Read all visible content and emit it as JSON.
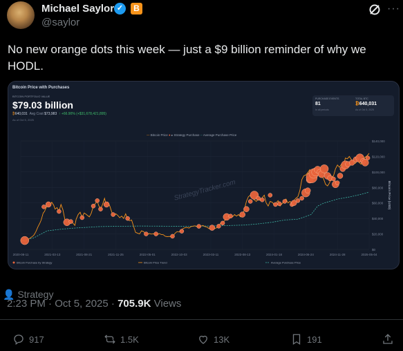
{
  "author": {
    "name": "Michael Saylor",
    "handle": "@saylor",
    "org_badge_letter": "B"
  },
  "tweet": {
    "text": "No new orange dots this week — just a $9 billion reminder of why we HODL."
  },
  "card": {
    "title": "Bitcoin Price with Purchases",
    "portfolio_label": "BITCOIN PORTFOLIO VALUE",
    "portfolio_value": "$79.03 billion",
    "btc_held": "640,031",
    "avg_cost_label": "Avg Cost",
    "avg_cost": "$73,983",
    "change": "↑ +66.90%",
    "change_detail": "(+$31,678,421,895)",
    "as_of": "As of Oct 5, 2025",
    "stats": {
      "events_label": "PURCHASE EVENTS",
      "events_value": "81",
      "events_sub": "In all periods",
      "total_label": "TOTAL BTC",
      "total_value": "640,031",
      "total_sub": "As of Oct 5, 2025"
    },
    "legend_top": {
      "series1": "Bitcoin Price",
      "series2": "Strategy Purchase",
      "series3": "Average Purchase Price"
    },
    "legend_bottom": {
      "item1": "Bitcoin Purchase by Strategy",
      "item2": "Bitcoin Price Trend",
      "item3": "Average Purchase Price"
    },
    "watermark": "StrategyTracker.com",
    "y_axis_title": "Bitcoin Price (USD)"
  },
  "chart_data": {
    "type": "line",
    "title": "Bitcoin Price with Purchases",
    "ylabel": "Bitcoin Price (USD)",
    "ylim": [
      0,
      140000
    ],
    "yticks": [
      "$0",
      "$20,000",
      "$40,000",
      "$60,000",
      "$80,000",
      "$100,000",
      "$120,000",
      "$140,000"
    ],
    "xticks": [
      "2020-08-11",
      "2021-03-13",
      "2021-08-21",
      "2021-11-25",
      "2022-05-01",
      "2022-10-03",
      "2023-03-11",
      "2023-08-13",
      "2024-01-18",
      "2024-06-24",
      "2024-11-28",
      "2025-05-04"
    ],
    "series": [
      {
        "name": "Bitcoin Price",
        "x": [
          0,
          4,
          7,
          10,
          14,
          18,
          20,
          23,
          26,
          29,
          31,
          34,
          36,
          39,
          42,
          44,
          47,
          50,
          52,
          55,
          58,
          61,
          64,
          67,
          70,
          73,
          76,
          79,
          82,
          84,
          87,
          90,
          93,
          96,
          98,
          101,
          104,
          107,
          110,
          113,
          116,
          118,
          121,
          124,
          127,
          129,
          132,
          135,
          138,
          141,
          144,
          147,
          150,
          153,
          156,
          159,
          162,
          165,
          168,
          171,
          174,
          177,
          180,
          183,
          186,
          189,
          192,
          195,
          198,
          201,
          204,
          207,
          210,
          213,
          216,
          219,
          222,
          225,
          228,
          231,
          234,
          237,
          240,
          243,
          246,
          249,
          252,
          255,
          258,
          261,
          264,
          267,
          270,
          273,
          276,
          279,
          282,
          285,
          288,
          291,
          294,
          297,
          300,
          303,
          306,
          309,
          312,
          315,
          318,
          321,
          324,
          327,
          330,
          333,
          336,
          339,
          342,
          345,
          348,
          351,
          354,
          357,
          360,
          363,
          366,
          369,
          372,
          375,
          378,
          381,
          384,
          387,
          390,
          393,
          396,
          399,
          402,
          405,
          408,
          411,
          414,
          417,
          420,
          423,
          426,
          429,
          432,
          435,
          438,
          441,
          444,
          447,
          450,
          453,
          456,
          459,
          462,
          465,
          468,
          471,
          474,
          477,
          480,
          483,
          486,
          489,
          492,
          495,
          498,
          501,
          504,
          507,
          510,
          513,
          516,
          519,
          522,
          525,
          528
        ],
        "values": [
          11500,
          11000,
          10800,
          12500,
          14500,
          17000,
          18500,
          23000,
          29000,
          34000,
          38000,
          47000,
          49000,
          55000,
          58000,
          56000,
          61000,
          57000,
          52000,
          54000,
          49000,
          58000,
          51000,
          38000,
          35000,
          32000,
          36000,
          34000,
          31000,
          39000,
          45000,
          48000,
          41000,
          47000,
          46000,
          44000,
          42000,
          47000,
          56000,
          59000,
          63000,
          57000,
          52000,
          58000,
          66000,
          59000,
          61000,
          56000,
          48000,
          43000,
          46000,
          44000,
          41000,
          43000,
          40000,
          46000,
          39000,
          37000,
          38000,
          30000,
          22000,
          21000,
          20000,
          24000,
          23000,
          21000,
          19500,
          20500,
          19800,
          20200,
          19500,
          19000,
          20500,
          19200,
          19000,
          17000,
          16500,
          16800,
          16700,
          17500,
          21000,
          23000,
          22500,
          24500,
          27000,
          28000,
          28500,
          27500,
          29500,
          30000,
          30500,
          29500,
          29000,
          30000,
          31000,
          29500,
          29000,
          27000,
          26000,
          26500,
          27000,
          28000,
          30000,
          34000,
          35000,
          37000,
          42000,
          43000,
          41000,
          42000,
          45000,
          43000,
          45000,
          42000,
          43000,
          52000,
          62000,
          68000,
          70000,
          66000,
          64000,
          62000,
          65000,
          63000,
          67000,
          70000,
          60000,
          56000,
          62000,
          61000,
          58000,
          60000,
          63000,
          56000,
          59000,
          62000,
          65000,
          60000,
          62000,
          60000,
          63000,
          66000,
          68000,
          76000,
          90000,
          95000,
          96000,
          99000,
          103000,
          97000,
          100000,
          105000,
          102000,
          94000,
          96000,
          91000,
          84000,
          82000,
          86000,
          93000,
          95000,
          104000,
          109000,
          106000,
          110000,
          108000,
          118000,
          117000,
          120000,
          116000,
          112000,
          111000,
          115000,
          112000,
          110000,
          116000,
          119000,
          121000,
          124000
        ]
      },
      {
        "name": "Average Purchase Price",
        "x": [
          0,
          20,
          40,
          60,
          80,
          100,
          120,
          140,
          160,
          180,
          200,
          220,
          240,
          260,
          280,
          300,
          320,
          340,
          360,
          380,
          400,
          420,
          440,
          450,
          460,
          480,
          500,
          520,
          528
        ],
        "values": [
          11100,
          15000,
          24000,
          26000,
          27500,
          28500,
          29500,
          29800,
          30000,
          30200,
          30100,
          30000,
          29900,
          30000,
          30200,
          30500,
          31000,
          31500,
          33000,
          35000,
          38000,
          39000,
          45000,
          56000,
          60000,
          65000,
          68000,
          72000,
          74000
        ]
      }
    ]
  },
  "attribution": "Strategy",
  "timestamp": "2:23 PM · Oct 5, 2025",
  "views_count": "705.9K",
  "views_label": "Views",
  "actions": {
    "replies": "917",
    "reposts": "1.5K",
    "likes": "13K",
    "bookmarks": "191"
  }
}
